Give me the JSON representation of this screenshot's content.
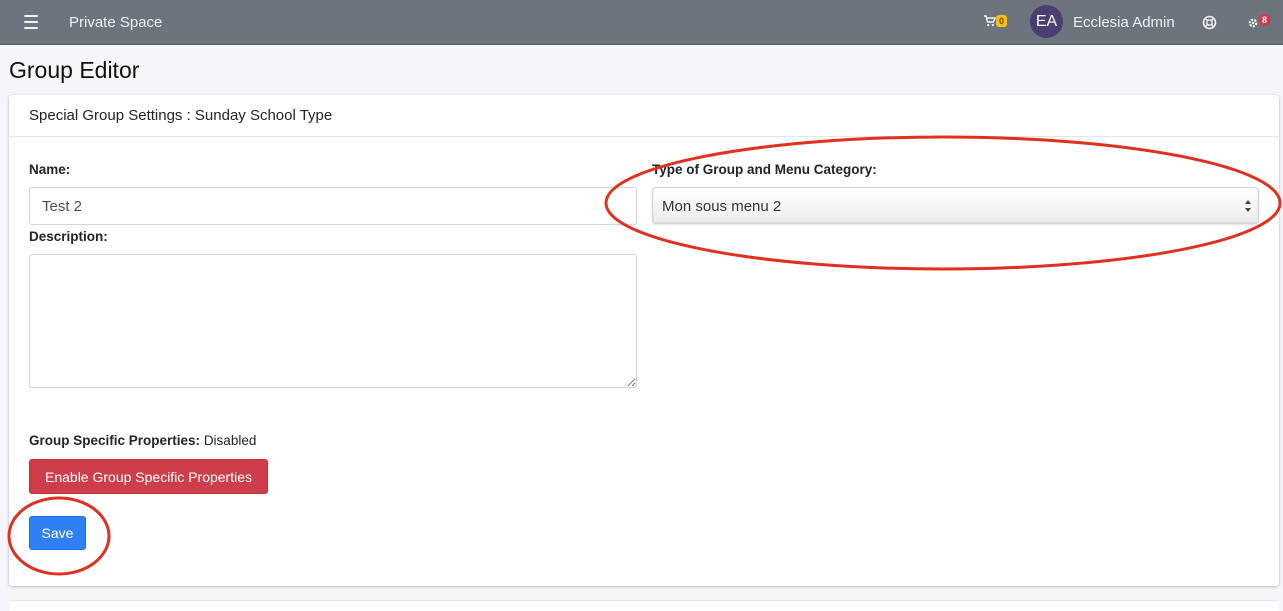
{
  "navbar": {
    "brand": "Private Space",
    "cart_count": "0",
    "avatar_initials": "EA",
    "username": "Ecclesia Admin",
    "notifications_count": "8"
  },
  "page": {
    "title": "Group Editor"
  },
  "card": {
    "title": "Special Group Settings : Sunday School Type"
  },
  "form": {
    "name_label": "Name:",
    "name_value": "Test 2",
    "description_label": "Description:",
    "description_value": "",
    "type_label": "Type of Group and Menu Category:",
    "type_selected": "Mon sous menu 2",
    "properties_label": "Group Specific Properties:",
    "properties_status": "Disabled",
    "enable_button": "Enable Group Specific Properties",
    "save_button": "Save"
  },
  "colors": {
    "navbar_bg": "#6c757d",
    "danger": "#ce3e4a",
    "primary": "#2f80f5",
    "annotation": "#e0301e"
  }
}
